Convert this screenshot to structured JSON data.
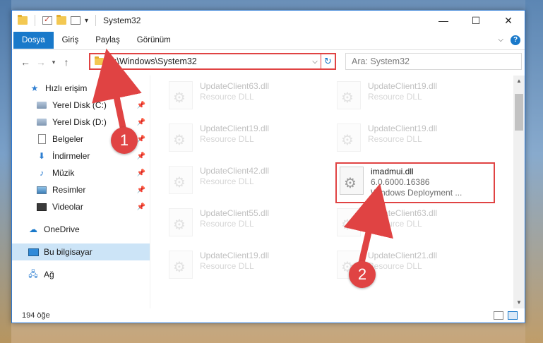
{
  "window": {
    "title": "System32",
    "controls": {
      "minimize": "—",
      "maximize": "☐",
      "close": "✕"
    }
  },
  "ribbon": {
    "tabs": [
      "Dosya",
      "Giriş",
      "Paylaş",
      "Görünüm"
    ],
    "active_tab": "Dosya",
    "help": "?"
  },
  "address_bar": {
    "path": "C:\\Windows\\System32"
  },
  "search": {
    "placeholder": "Ara: System32"
  },
  "nav_pane": {
    "quick_access": "Hızlı erişim",
    "pinned": [
      {
        "label": "Yerel Disk (C:)",
        "icon": "disk-icon"
      },
      {
        "label": "Yerel Disk (D:)",
        "icon": "disk-icon"
      },
      {
        "label": "Belgeler",
        "icon": "document-icon"
      },
      {
        "label": "İndirmeler",
        "icon": "download-icon"
      },
      {
        "label": "Müzik",
        "icon": "music-icon"
      },
      {
        "label": "Resimler",
        "icon": "pictures-icon"
      },
      {
        "label": "Videolar",
        "icon": "video-icon"
      }
    ],
    "onedrive": "OneDrive",
    "this_pc": "Bu bilgisayar",
    "network": "Ağ"
  },
  "files": [
    {
      "name": "UpdateClient63.dll",
      "type": "Resource DLL"
    },
    {
      "name": "UpdateClient19.dll",
      "type": "Resource DLL"
    },
    {
      "name": "UpdateClient19.dll",
      "type": "Resource DLL"
    },
    {
      "name": "UpdateClient19.dll",
      "type": "Resource DLL"
    },
    {
      "name": "UpdateClient42.dll",
      "type": "Resource DLL"
    },
    {
      "name": "imadmui.dll",
      "version": "6.0.6000.16386",
      "description": "Windows Deployment ..."
    },
    {
      "name": "UpdateClient55.dll",
      "type": "Resource DLL"
    },
    {
      "name": "UpdateClient63.dll",
      "type": "Resource DLL"
    },
    {
      "name": "UpdateClient19.dll",
      "type": "Resource DLL"
    },
    {
      "name": "UpdateClient21.dll",
      "type": "Resource DLL"
    }
  ],
  "status": {
    "item_count": "194 öğe"
  },
  "annotations": {
    "step1": "1",
    "step2": "2",
    "highlight_color": "#e04343"
  }
}
